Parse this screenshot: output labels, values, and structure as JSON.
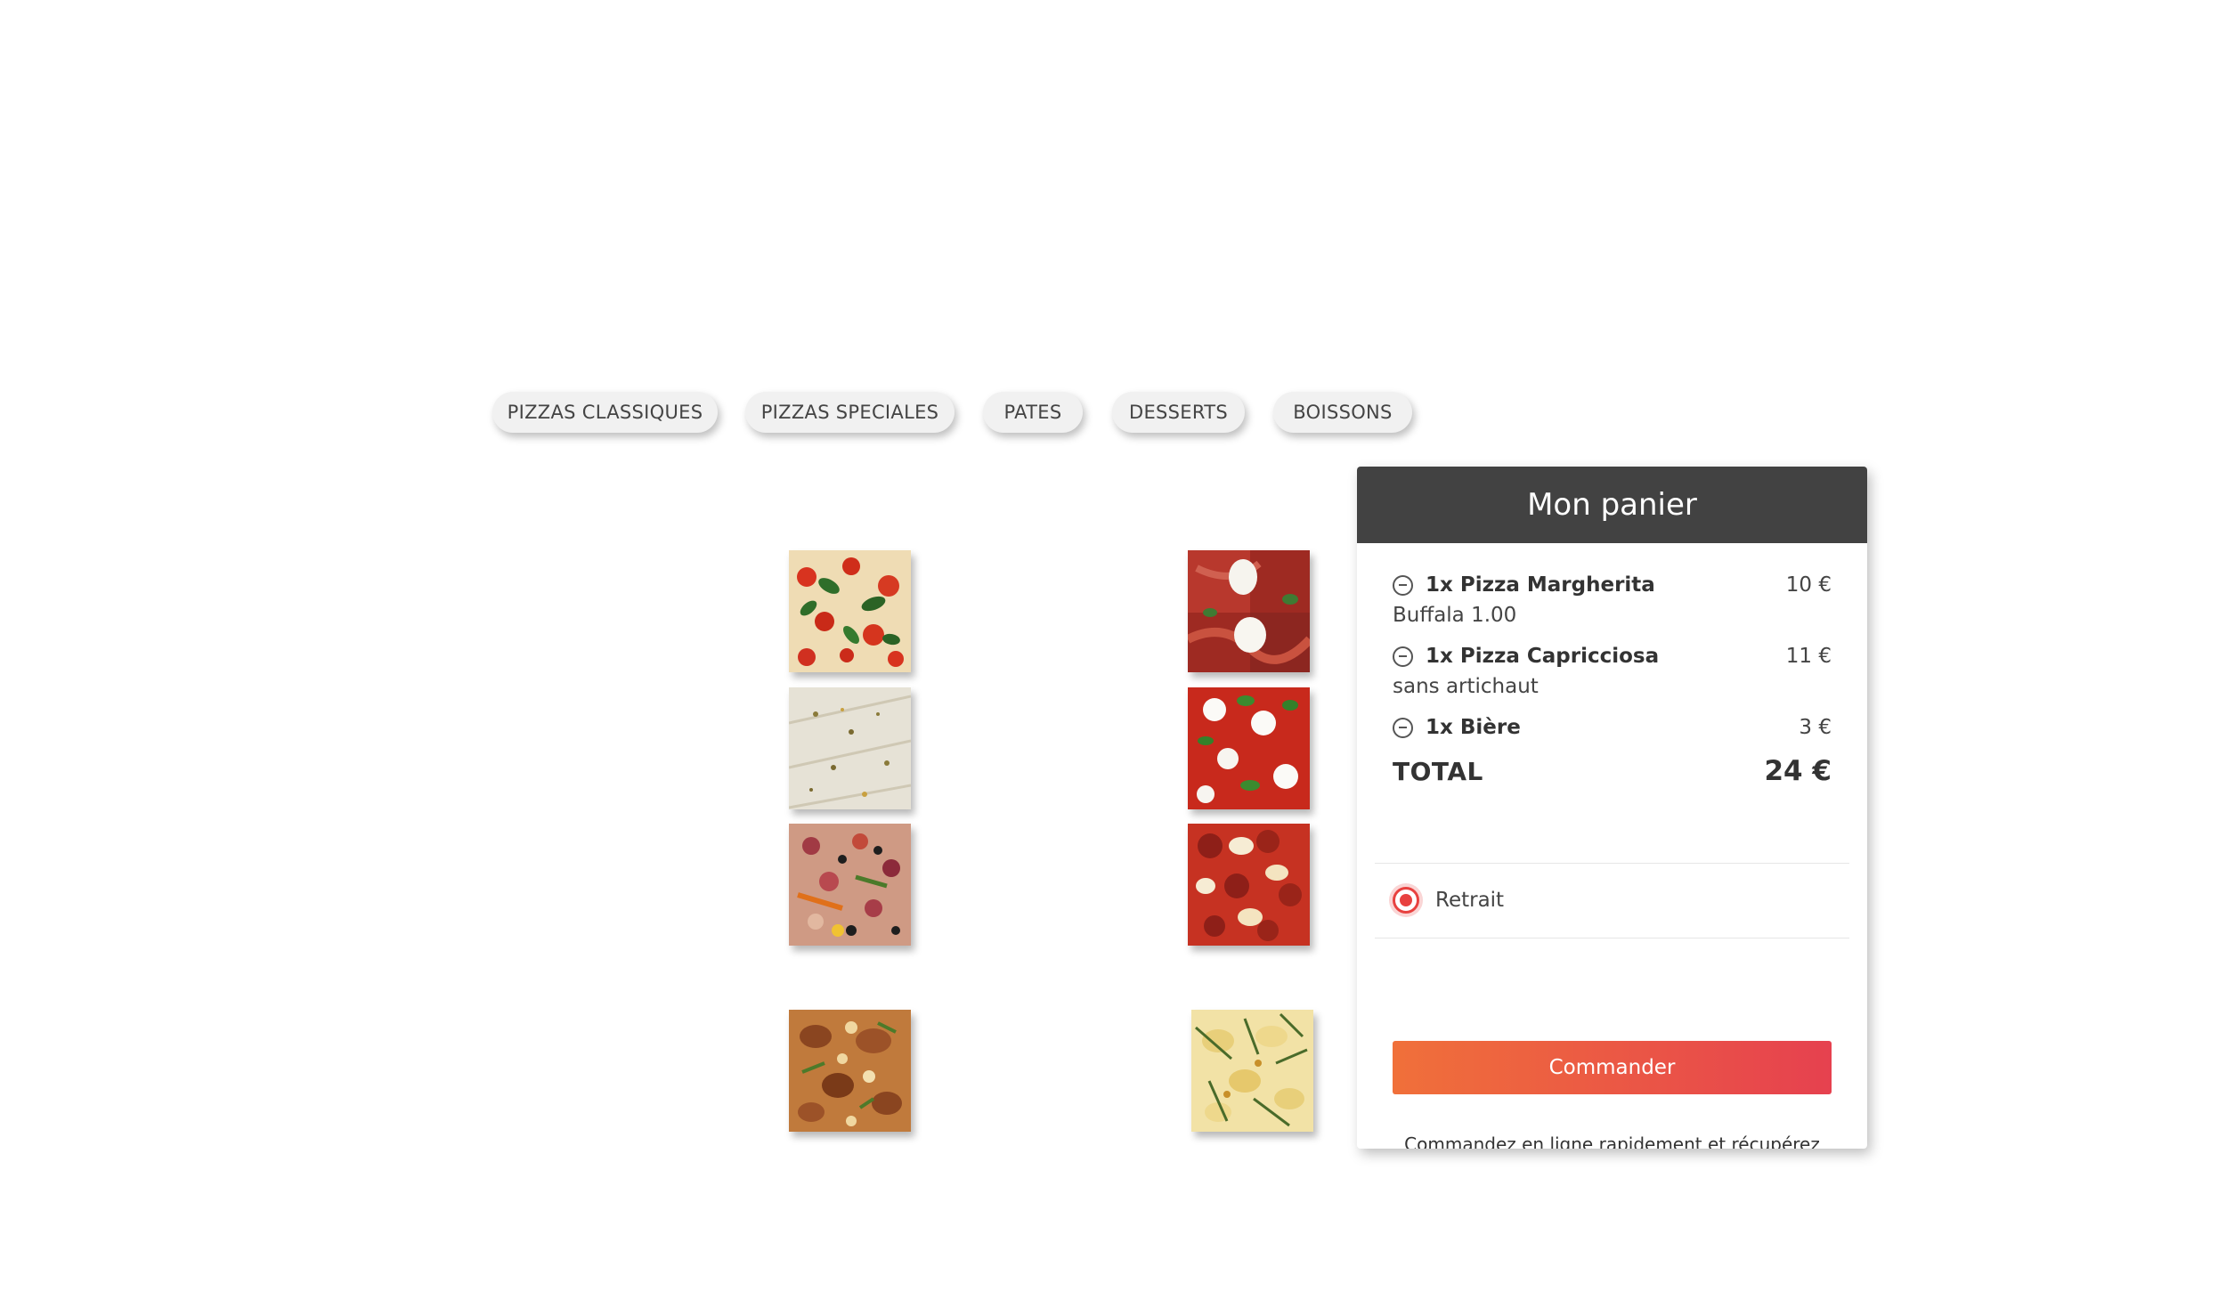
{
  "categories": [
    {
      "label": "PIZZAS CLASSIQUES"
    },
    {
      "label": "PIZZAS SPECIALES"
    },
    {
      "label": "PATES"
    },
    {
      "label": "DESSERTS"
    },
    {
      "label": "BOISSONS"
    }
  ],
  "menu_images": [
    {
      "icon": "pizza-margherita-image"
    },
    {
      "icon": "pizza-prosciutto-burrata-image"
    },
    {
      "icon": "pizza-bianca-image"
    },
    {
      "icon": "pizza-ricotta-basil-image"
    },
    {
      "icon": "pizza-capricciosa-image"
    },
    {
      "icon": "pizza-pepperoni-mozzarella-image"
    },
    {
      "icon": "pizza-bbq-chicken-image"
    },
    {
      "icon": "pizza-rosemary-potato-image"
    }
  ],
  "cart": {
    "title": "Mon panier",
    "items": [
      {
        "name": "1x Pizza Margherita",
        "price": "10 €",
        "note": "Buffala 1.00"
      },
      {
        "name": "1x Pizza Capricciosa",
        "price": "11 €",
        "note": "sans artichaut"
      },
      {
        "name": "1x Bière",
        "price": "3 €",
        "note": ""
      }
    ],
    "total_label": "TOTAL",
    "total_value": "24 €",
    "pickup_label": "Retrait",
    "pickup_selected": true,
    "order_button": "Commander",
    "note": "Commandez en ligne rapidement et récupérez votre commande dans l'heure !"
  },
  "colors": {
    "header_bg": "#424242",
    "accent_start": "#f0703a",
    "accent_end": "#e6414f",
    "radio": "#e8413f"
  }
}
